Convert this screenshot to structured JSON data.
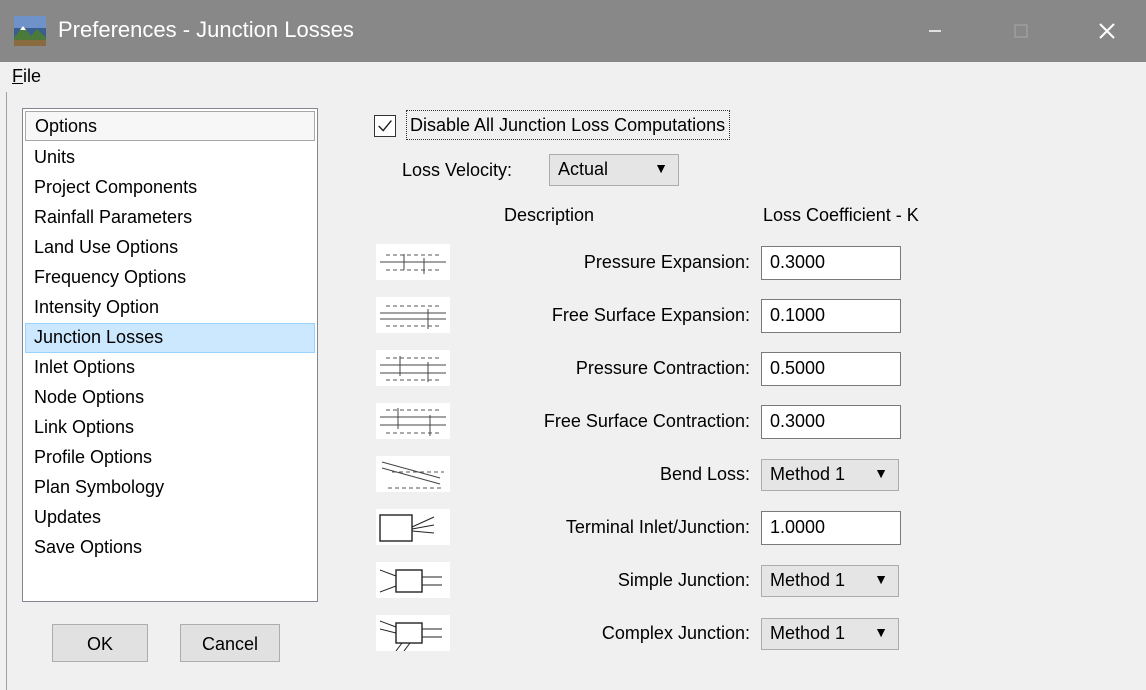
{
  "window": {
    "title": "Preferences - Junction Losses",
    "icon": "landscape-app-icon",
    "controls": [
      "minimize-icon",
      "maximize-icon",
      "close-icon"
    ]
  },
  "menu": {
    "file_label": "File",
    "file_mnemonic": "F",
    "file_rest": "ile"
  },
  "options": {
    "header": "Options",
    "items": [
      "Units",
      "Project Components",
      "Rainfall Parameters",
      "Land Use Options",
      "Frequency Options",
      "Intensity Option",
      "Junction Losses",
      "Inlet Options",
      "Node Options",
      "Link Options",
      "Profile Options",
      "Plan Symbology",
      "Updates",
      "Save Options"
    ],
    "selected": "Junction Losses"
  },
  "buttons": {
    "ok": "OK",
    "cancel": "Cancel"
  },
  "disable_all": {
    "label": "Disable All Junction Loss Computations",
    "checked": true
  },
  "loss_velocity": {
    "label": "Loss Velocity:",
    "value": "Actual"
  },
  "columns": {
    "description": "Description",
    "coefficient": "Loss Coefficient - K"
  },
  "rows": [
    {
      "label": "Pressure Expansion:",
      "kind": "input",
      "value": "0.3000",
      "icon": "pressure-expansion-icon"
    },
    {
      "label": "Free Surface Expansion:",
      "kind": "input",
      "value": "0.1000",
      "icon": "free-surface-expansion-icon"
    },
    {
      "label": "Pressure Contraction:",
      "kind": "input",
      "value": "0.5000",
      "icon": "pressure-contraction-icon"
    },
    {
      "label": "Free Surface Contraction:",
      "kind": "input",
      "value": "0.3000",
      "icon": "free-surface-contraction-icon"
    },
    {
      "label": "Bend Loss:",
      "kind": "select",
      "value": "Method 1",
      "icon": "bend-loss-icon"
    },
    {
      "label": "Terminal Inlet/Junction:",
      "kind": "input",
      "value": "1.0000",
      "icon": "terminal-inlet-icon"
    },
    {
      "label": "Simple Junction:",
      "kind": "select",
      "value": "Method 1",
      "icon": "simple-junction-icon"
    },
    {
      "label": "Complex Junction:",
      "kind": "select",
      "value": "Method 1",
      "icon": "complex-junction-icon"
    }
  ],
  "colors": {
    "titlebar": "#888888",
    "selection": "#cce8ff",
    "selection_border": "#99d1ff",
    "window_bg": "#f0f0f0"
  }
}
